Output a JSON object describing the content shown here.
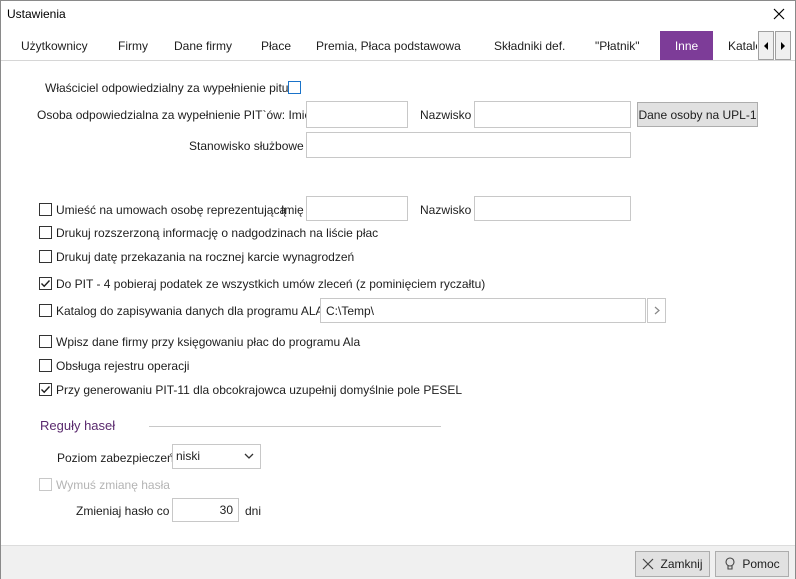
{
  "window": {
    "title": "Ustawienia"
  },
  "tabs": [
    {
      "label": "Użytkownicy"
    },
    {
      "label": "Firmy"
    },
    {
      "label": "Dane firmy"
    },
    {
      "label": "Płace"
    },
    {
      "label": "Premia, Płaca podstawowa"
    },
    {
      "label": "Składniki def."
    },
    {
      "label": "\"Płatnik\""
    },
    {
      "label": "Inne"
    },
    {
      "label": "Katalo"
    }
  ],
  "pit": {
    "owner_label": "Właściciel odpowiedzialny za wypełnienie pitu",
    "person_label": "Osoba odpowiedzialna za wypełnienie PIT`ów: Imię",
    "first_name_value": "",
    "surname_label": "Nazwisko",
    "surname_value": "",
    "upl_button": "Dane osoby na UPL-1",
    "position_label": "Stanowisko służbowe",
    "position_value": ""
  },
  "options": {
    "representative_label": "Umieść na umowach osobę reprezentującą",
    "rep_first_name_label": "Imię",
    "rep_first_name_value": "",
    "rep_surname_label": "Nazwisko",
    "rep_surname_value": "",
    "overtime_label": "Drukuj rozszerzoną informację o nadgodzinach na liście płac",
    "handover_label": "Drukuj datę przekazania na rocznej karcie wynagrodzeń",
    "pit4_label": "Do PIT - 4 pobieraj podatek ze wszystkich umów zleceń (z pominięciem ryczałtu)",
    "ala_label": "Katalog do zapisywania danych dla programu ALA:",
    "ala_path": "C:\\Temp\\",
    "ala_company_label": "Wpisz dane firmy przy księgowaniu płac do programu Ala",
    "operations_label": "Obsługa rejestru operacji",
    "pit11_label": "Przy generowaniu PIT-11 dla obcokrajowca uzupełnij domyślnie pole PESEL"
  },
  "passwords": {
    "section_title": "Reguły haseł",
    "level_label": "Poziom zabezpieczeń",
    "level_value": "niski",
    "force_change_label": "Wymuś zmianę hasła",
    "change_every_label": "Zmieniaj hasło co",
    "change_every_value": "30",
    "days_label": "dni"
  },
  "footer": {
    "close_label": "Zamknij",
    "help_label": "Pomoc"
  }
}
